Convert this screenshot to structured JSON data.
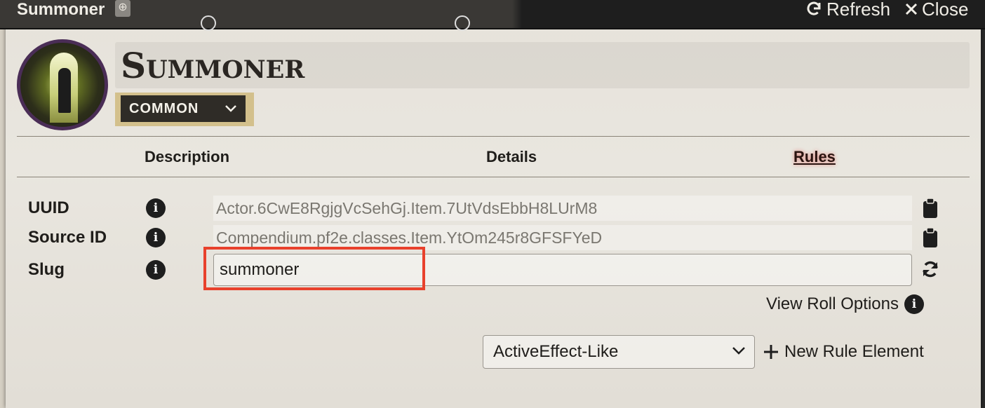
{
  "window": {
    "title": "Summoner",
    "refresh_label": "Refresh",
    "close_label": "Close"
  },
  "item": {
    "name": "Summoner",
    "rarity": "COMMON"
  },
  "tabs": [
    {
      "label": "Description",
      "active": false
    },
    {
      "label": "Details",
      "active": false
    },
    {
      "label": "Rules",
      "active": true
    }
  ],
  "fields": {
    "uuid": {
      "label": "UUID",
      "value": "Actor.6CwE8RgjgVcSehGj.Item.7UtVdsEbbH8LUrM8"
    },
    "source_id": {
      "label": "Source ID",
      "value": "Compendium.pf2e.classes.Item.YtOm245r8GFSFYeD"
    },
    "slug": {
      "label": "Slug",
      "value": "summoner"
    }
  },
  "rules": {
    "view_roll_options_label": "View Roll Options",
    "rule_type_selected": "ActiveEffect-Like",
    "new_rule_label": "New Rule Element"
  },
  "colors": {
    "highlight": "#e8412c",
    "rarity_border": "#d3c08c",
    "rarity_bg": "#2f2c27",
    "portrait_border": "#4a2d56"
  }
}
